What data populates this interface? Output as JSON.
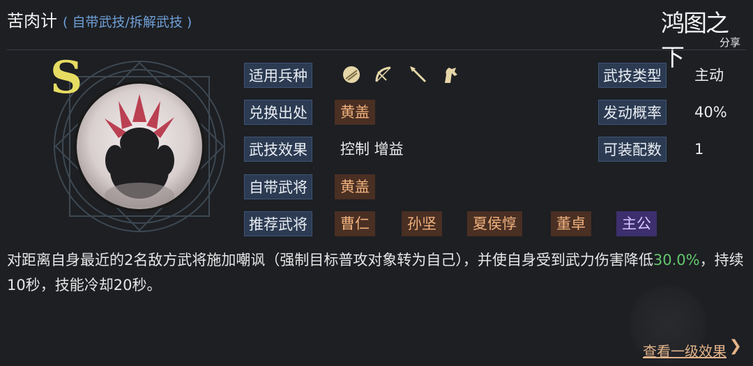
{
  "header": {
    "title": "苦肉计",
    "subtitle": "( 自带武技/拆解武技 )"
  },
  "brand": {
    "logo_text": "鸿图之下",
    "share_label": "分享"
  },
  "skill": {
    "grade": "S",
    "fields": {
      "unit_types_label": "适用兵种",
      "unit_icons": [
        "shield-icon",
        "bow-icon",
        "spear-icon",
        "horse-icon"
      ],
      "skill_type_label": "武技类型",
      "skill_type_value": "主动",
      "source_label": "兑换出处",
      "source_value": "黄盖",
      "trigger_rate_label": "发动概率",
      "trigger_rate_value": "40%",
      "effect_label": "武技效果",
      "effect_value": "控制 增益",
      "equip_count_label": "可装配数",
      "equip_count_value": "1",
      "own_general_label": "自带武将",
      "own_general_value": "黄盖",
      "recommended_label": "推荐武将",
      "recommended": [
        "曹仁",
        "孙坚",
        "夏侯惇",
        "董卓",
        "主公"
      ]
    },
    "description": {
      "text_before": "对距离自身最近的2名敌方武将施加嘲讽（强制目标普攻对象转为自己），并使自身受到武力伤害降低",
      "highlight": "30.0%",
      "text_after": "，持续10秒，技能冷却20秒。"
    }
  },
  "footer": {
    "view_level1_link": "查看一级效果",
    "chevron": "❯"
  },
  "colors": {
    "background": "#1d1f23",
    "label_bg": "#2c3b52",
    "tag_bg": "#4a2f23",
    "tag_text": "#f1b27d",
    "lord_tag_bg": "#3d2f6e",
    "highlight_green": "#63c76d",
    "link_color": "#e3b38a",
    "grade_color": "#e7dc62"
  }
}
